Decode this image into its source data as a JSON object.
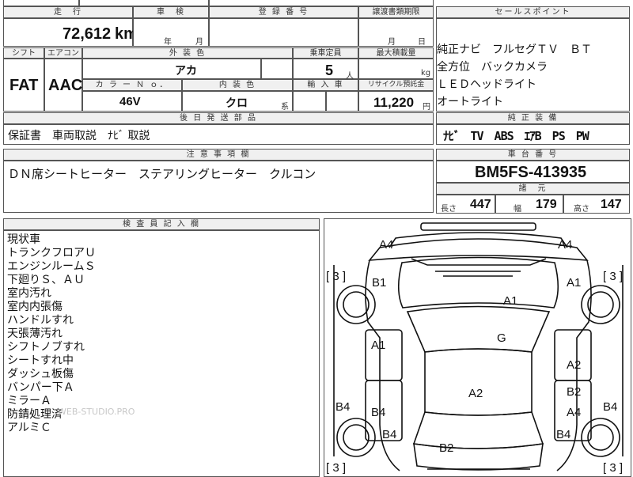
{
  "top": {
    "mileage_header": "走　行",
    "mileage_value": "72,612",
    "mileage_unit": "km",
    "shaken_header": "車　検",
    "shaken_year": "年",
    "shaken_month": "月",
    "reg_header": "登 録 番 号",
    "transfer_header": "譲渡書類期限",
    "transfer_month": "月",
    "transfer_day": "日",
    "sales_header": "セールスポイント"
  },
  "mid": {
    "shift_header": "シフト",
    "ac_header": "エアコン",
    "exterior_header": "外 装 色",
    "capacity_header": "乗車定員",
    "load_header": "最大積載量",
    "shift_value": "FAT",
    "ac_value": "AAC",
    "exterior_value": "アカ",
    "capacity_value": "5",
    "capacity_unit": "人",
    "load_unit": "kg",
    "color_no_header": "カ ラ ー Ｎ ｏ．",
    "interior_header": "内 装 色",
    "import_header": "輸 入 車",
    "recycle_header": "リサイクル預託金",
    "color_no_value": "46V",
    "interior_value": "クロ",
    "interior_suffix": "系",
    "recycle_value": "11,220",
    "recycle_unit": "円"
  },
  "sales_points": [
    "純正ナビ　フルセグＴＶ　ＢＴ",
    "全方位　バックカメラ",
    "ＬＥＤヘッドライト",
    "オートライト"
  ],
  "later_parts": {
    "header": "後 日 発 送 部 品",
    "value": "保証書　車両取説　ﾅﾋﾞ 取説"
  },
  "equipment": {
    "header": "純 正 装 備",
    "value": "ﾅﾋﾞ　TV　ABS　ｴｱB　PS　PW"
  },
  "notes": {
    "header": "注 意 事 項 欄",
    "value": "ＤＮ席シートヒーター　ステアリングヒーター　クルコン"
  },
  "chassis": {
    "header": "車 台 番 号",
    "value": "BM5FS-413935"
  },
  "specs": {
    "header": "諸　元",
    "length_label": "長さ",
    "length_value": "447",
    "width_label": "幅",
    "width_value": "179",
    "height_label": "高さ",
    "height_value": "147"
  },
  "inspector": {
    "header": "検 査 員 記 入 欄",
    "lines": [
      "現状車",
      "トランクフロアＵ",
      "エンジンルームＳ",
      "下廻りＳ、ＡＵ",
      "室内汚れ",
      "室内内張傷",
      "ハンドルすれ",
      "天張薄汚れ",
      "シフトノブすれ",
      "シートすれ中",
      "ダッシュ板傷",
      "バンパー下Ａ",
      "ミラーＡ",
      "防錆処理済",
      "アルミＣ"
    ],
    "watermark": "WEB-STUDIO.PRO"
  },
  "diagram": {
    "labels": [
      {
        "text": "A4"
      },
      {
        "text": "A4"
      },
      {
        "text": "[ 3 ]"
      },
      {
        "text": "[ 3 ]"
      },
      {
        "text": "B1"
      },
      {
        "text": "A1"
      },
      {
        "text": "A1"
      },
      {
        "text": "G"
      },
      {
        "text": "A1"
      },
      {
        "text": "A2"
      },
      {
        "text": "A2"
      },
      {
        "text": "B2"
      },
      {
        "text": "B4"
      },
      {
        "text": "B4"
      },
      {
        "text": "A4"
      },
      {
        "text": "B4"
      },
      {
        "text": "B4"
      },
      {
        "text": "B4"
      },
      {
        "text": "B2"
      },
      {
        "text": "[ 3 ]"
      },
      {
        "text": "[ 3 ]"
      }
    ]
  }
}
